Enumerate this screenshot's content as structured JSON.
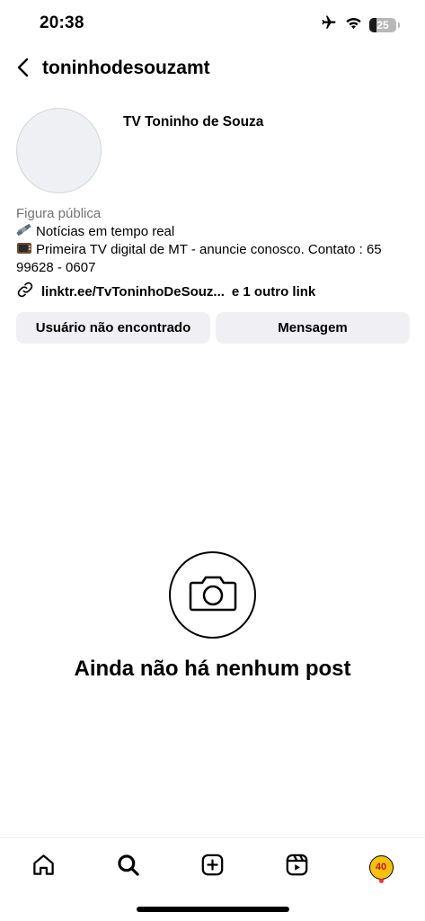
{
  "status_bar": {
    "time": "20:38",
    "battery_level": "25",
    "icons": [
      "airplane-icon",
      "wifi-icon",
      "battery-icon"
    ]
  },
  "header": {
    "username": "toninhodesouzamt",
    "back_icon": "chevron-left-icon"
  },
  "profile": {
    "display_name": "TV Toninho de Souza",
    "category": "Figura pública",
    "bio_line1": "Notícias em tempo real",
    "bio_line2": "Primeira TV digital de MT - anuncie conosco. Contato : 65 99628 - 0607",
    "link_text": "linktr.ee/TvToninhoDeSouz...",
    "link_extra": "e 1 outro link"
  },
  "actions": {
    "primary": "Usuário não encontrado",
    "secondary": "Mensagem"
  },
  "empty_state": {
    "message": "Ainda não há nenhum post",
    "icon": "camera-icon"
  },
  "nav": {
    "items": [
      "home-icon",
      "search-icon",
      "create-icon",
      "reels-icon",
      "profile-avatar"
    ],
    "profile_avatar_text": "40"
  },
  "colors": {
    "category_gray": "#737373",
    "button_bg": "#efeff4",
    "notification_dot": "#ff3040"
  }
}
